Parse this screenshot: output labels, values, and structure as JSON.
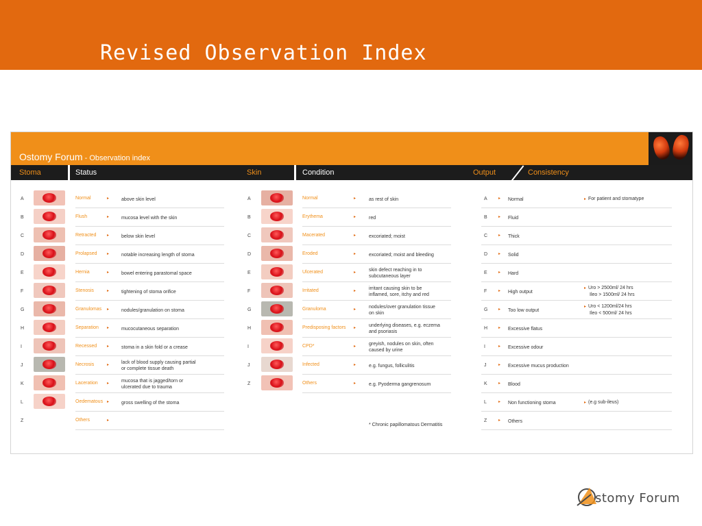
{
  "slide": {
    "title": "Revised Observation Index"
  },
  "panel": {
    "title": "Ostomy Forum",
    "subtitle": " - Observation index",
    "headers": {
      "stoma": "Stoma",
      "status": "Status",
      "skin": "Skin",
      "condition": "Condition",
      "output": "Output",
      "consistency": "Consistency"
    }
  },
  "stoma_rows": [
    {
      "letter": "A",
      "term": "Normal",
      "desc": [
        "above skin level"
      ]
    },
    {
      "letter": "B",
      "term": "Flush",
      "desc": [
        "mucosa level with the skin"
      ]
    },
    {
      "letter": "C",
      "term": "Retracted",
      "desc": [
        "below skin level"
      ]
    },
    {
      "letter": "D",
      "term": "Prolapsed",
      "desc": [
        "notable increasing length of stoma"
      ]
    },
    {
      "letter": "E",
      "term": "Hernia",
      "desc": [
        "bowel entering parastomal space"
      ]
    },
    {
      "letter": "F",
      "term": "Stenosis",
      "desc": [
        "tightening of stoma orifice"
      ]
    },
    {
      "letter": "G",
      "term": "Granulomas",
      "desc": [
        "nodules/granulation on stoma"
      ]
    },
    {
      "letter": "H",
      "term": "Separation",
      "desc": [
        "mucocutaneous separation"
      ]
    },
    {
      "letter": "I",
      "term": "Recessed",
      "desc": [
        "stoma in a skin fold or a crease"
      ]
    },
    {
      "letter": "J",
      "term": "Necrosis",
      "desc": [
        "lack of blood supply causing partial",
        "or complete tissue death"
      ]
    },
    {
      "letter": "K",
      "term": "Laceration",
      "desc": [
        "mucosa that is jagged/torn or",
        "ulcerated due to trauma"
      ]
    },
    {
      "letter": "L",
      "term": "Oedematous",
      "desc": [
        "gross swelling of the stoma"
      ]
    },
    {
      "letter": "Z",
      "term": "Others",
      "desc": []
    }
  ],
  "skin_rows": [
    {
      "letter": "A",
      "term": "Normal",
      "desc": [
        "as rest of skin"
      ]
    },
    {
      "letter": "B",
      "term": "Erythema",
      "desc": [
        "red"
      ]
    },
    {
      "letter": "C",
      "term": "Macerated",
      "desc": [
        "excoriated; moist"
      ]
    },
    {
      "letter": "D",
      "term": "Eroded",
      "desc": [
        "excoriated; moist and bleeding"
      ]
    },
    {
      "letter": "E",
      "term": "Ulcerated",
      "desc": [
        "skin defect reaching in to",
        "subcutaneous layer"
      ]
    },
    {
      "letter": "F",
      "term": "Irritated",
      "desc": [
        "irritant causing skin to be",
        "inflamed, sore, itchy and red"
      ]
    },
    {
      "letter": "G",
      "term": "Granuloma",
      "desc": [
        "nodules/over granulation tissue",
        "on skin"
      ]
    },
    {
      "letter": "H",
      "term": "Predisposing factors",
      "desc": [
        "underlying diseases, e.g. eczema",
        "and psoriasis"
      ]
    },
    {
      "letter": "I",
      "term": "CPD*",
      "desc": [
        "greyish, nodules on skin, often",
        "caused by urine"
      ]
    },
    {
      "letter": "J",
      "term": "Infected",
      "desc": [
        "e.g. fungus, folliculitis"
      ]
    },
    {
      "letter": "Z",
      "term": "Others",
      "desc": [
        "e.g. Pyoderma gangrenosum"
      ]
    }
  ],
  "footnote": "* Chronic papillomatous Dermatitis",
  "output_rows": [
    {
      "letter": "A",
      "label": "Normal",
      "extra": [
        "For patient and stomatype"
      ]
    },
    {
      "letter": "B",
      "label": "Fluid",
      "extra": []
    },
    {
      "letter": "C",
      "label": "Thick",
      "extra": []
    },
    {
      "letter": "D",
      "label": "Solid",
      "extra": []
    },
    {
      "letter": "E",
      "label": "Hard",
      "extra": []
    },
    {
      "letter": "F",
      "label": "High output",
      "extra": [
        "Uro > 2500ml/ 24 hrs",
        "Ileo > 1500ml/ 24 hrs"
      ]
    },
    {
      "letter": "G",
      "label": "Too low output",
      "extra": [
        "Uro < 1200ml/24 hrs",
        "Ileo < 500ml/ 24 hrs"
      ]
    },
    {
      "letter": "H",
      "label": "Excessive flatus",
      "extra": []
    },
    {
      "letter": "I",
      "label": "Excessive odour",
      "extra": []
    },
    {
      "letter": "J",
      "label": "Excessive mucus production",
      "extra": []
    },
    {
      "letter": "K",
      "label": "Blood",
      "extra": []
    },
    {
      "letter": "L",
      "label": "Non functioning stoma",
      "extra": [
        "(e.g sub-ileus)"
      ]
    },
    {
      "letter": "Z",
      "label": "Others",
      "extra": []
    }
  ],
  "arrow_glyph": "▸",
  "brand": {
    "letter": "O",
    "rest": "stomy Forum"
  },
  "colors": {
    "title_bar": "#e2690f",
    "panel_orange": "#f08f19",
    "header_dark": "#1c1c1c",
    "stoma_red": "#d80f17"
  }
}
